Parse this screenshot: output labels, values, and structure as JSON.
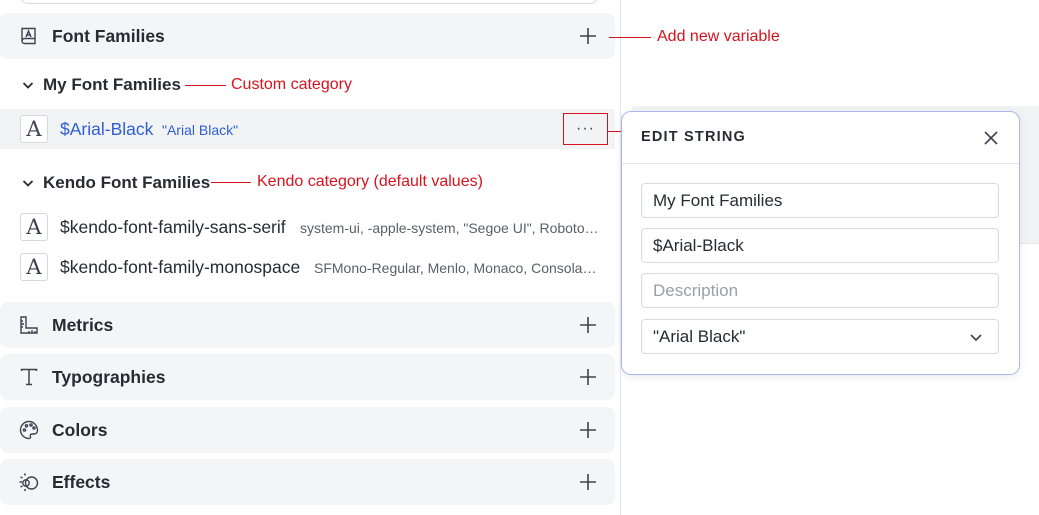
{
  "sections": {
    "font_families": {
      "title": "Font Families",
      "icon": "font-book-icon"
    },
    "metrics": {
      "title": "Metrics",
      "icon": "ruler-icon"
    },
    "typographies": {
      "title": "Typographies",
      "icon": "text-t-icon"
    },
    "colors": {
      "title": "Colors",
      "icon": "palette-icon"
    },
    "effects": {
      "title": "Effects",
      "icon": "effects-icon"
    }
  },
  "categories": {
    "my": {
      "title": "My Font Families"
    },
    "kendo": {
      "title": "Kendo Font Families"
    }
  },
  "variables": {
    "arial_black": {
      "name": "$Arial-Black",
      "value": "\"Arial Black\""
    },
    "sans_serif": {
      "name": "$kendo-font-family-sans-serif",
      "value": "system-ui, -apple-system, \"Segoe UI\", Roboto, \"Helvetica Neue\", Arial"
    },
    "monospace": {
      "name": "$kendo-font-family-monospace",
      "value": "SFMono-Regular, Menlo, Monaco, Consolas, \"Liberation Mono\""
    }
  },
  "type_icon_glyph": "A",
  "more_label": "···",
  "annotations": {
    "add_new": "Add new variable",
    "custom": "Custom category",
    "kendo": "Kendo category (default values)"
  },
  "edit_popup": {
    "title": "EDIT STRING",
    "category_value": "My Font Families",
    "name_value": "$Arial-Black",
    "description_placeholder": "Description",
    "value_selected": "\"Arial Black\""
  },
  "colors": {
    "accent_blue": "#2d5fd4",
    "annotation_red": "#d6131e",
    "popup_border": "#aeb7ea"
  }
}
